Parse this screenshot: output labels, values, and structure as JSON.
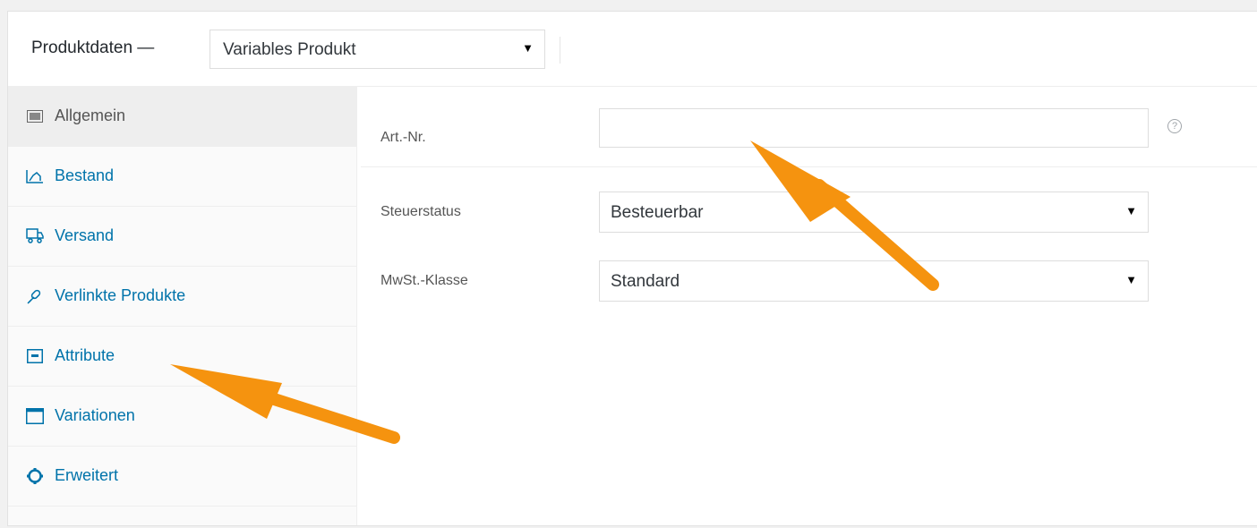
{
  "header": {
    "title": "Produktdaten —",
    "product_type": "Variables Produkt"
  },
  "sidebar": {
    "items": [
      {
        "label": "Allgemein",
        "icon": "general-icon",
        "active": true
      },
      {
        "label": "Bestand",
        "icon": "inventory-icon",
        "active": false
      },
      {
        "label": "Versand",
        "icon": "shipping-icon",
        "active": false
      },
      {
        "label": "Verlinkte Produkte",
        "icon": "link-icon",
        "active": false
      },
      {
        "label": "Attribute",
        "icon": "attribute-icon",
        "active": false
      },
      {
        "label": "Variationen",
        "icon": "variations-icon",
        "active": false
      },
      {
        "label": "Erweitert",
        "icon": "gear-icon",
        "active": false
      }
    ]
  },
  "main": {
    "sku": {
      "label": "Art.-Nr.",
      "value": "",
      "help": "?"
    },
    "tax_status": {
      "label": "Steuerstatus",
      "value": "Besteuerbar"
    },
    "tax_class": {
      "label": "MwSt.-Klasse",
      "value": "Standard"
    }
  },
  "colors": {
    "accent": "#0073aa",
    "annotation_arrow": "#f5930f"
  }
}
